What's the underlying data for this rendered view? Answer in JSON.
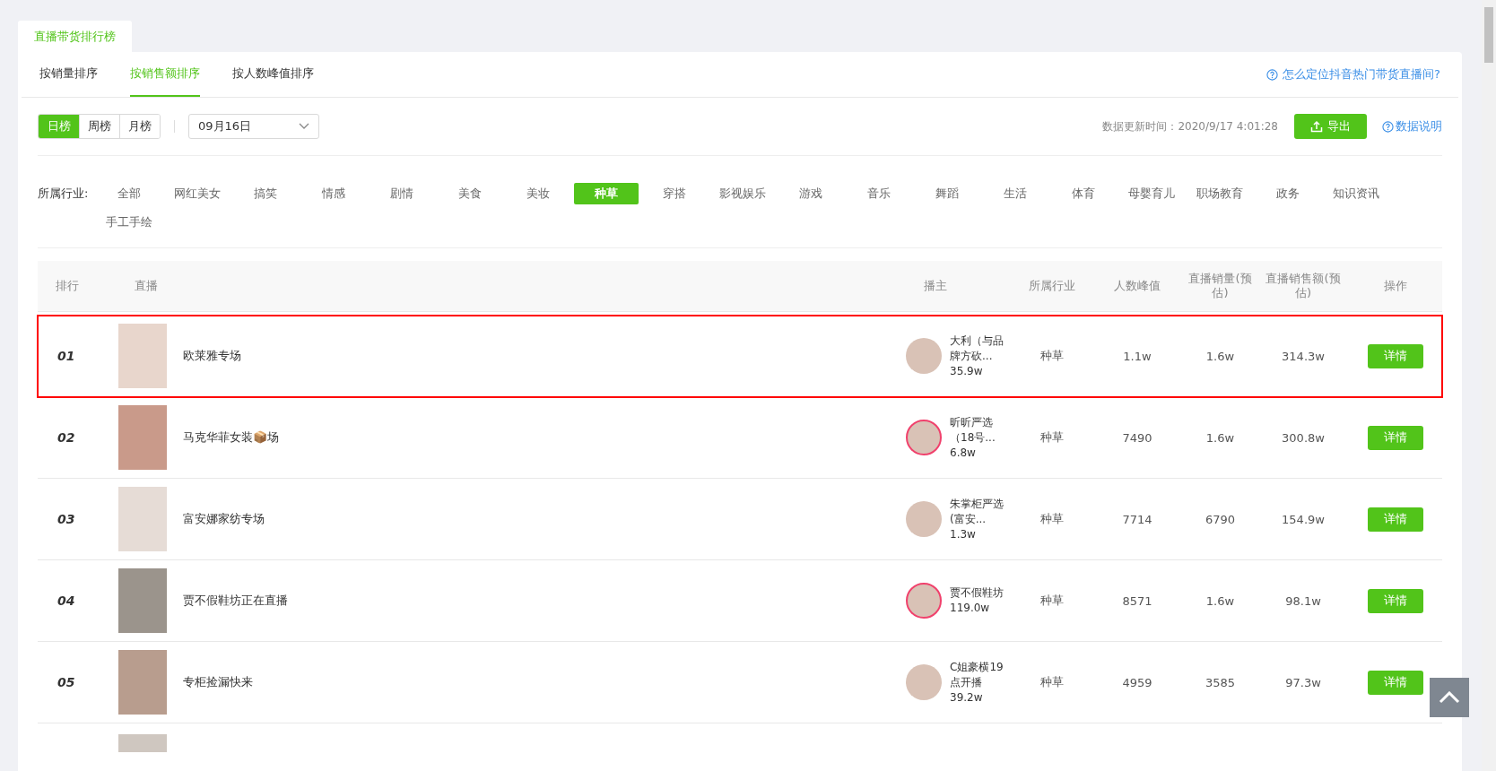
{
  "page_tab": {
    "label": "直播带货排行榜",
    "selected": true
  },
  "sort_tabs": [
    {
      "label": "按销量排序",
      "selected": false
    },
    {
      "label": "按销售额排序",
      "selected": true
    },
    {
      "label": "按人数峰值排序",
      "selected": false
    }
  ],
  "help_link": "怎么定位抖音热门带货直播间?",
  "period_tabs": [
    {
      "label": "日榜",
      "selected": true
    },
    {
      "label": "周榜",
      "selected": false
    },
    {
      "label": "月榜",
      "selected": false
    }
  ],
  "date_select": {
    "value": "09月16日"
  },
  "update_time": "数据更新时间：2020/9/17 4:01:28",
  "export_button": "导出",
  "data_note_link": "数据说明",
  "industry": {
    "label": "所属行业:",
    "items": [
      {
        "label": "全部",
        "selected": false
      },
      {
        "label": "网红美女",
        "selected": false
      },
      {
        "label": "搞笑",
        "selected": false
      },
      {
        "label": "情感",
        "selected": false
      },
      {
        "label": "剧情",
        "selected": false
      },
      {
        "label": "美食",
        "selected": false
      },
      {
        "label": "美妆",
        "selected": false
      },
      {
        "label": "种草",
        "selected": true
      },
      {
        "label": "穿搭",
        "selected": false
      },
      {
        "label": "影视娱乐",
        "selected": false
      },
      {
        "label": "游戏",
        "selected": false
      },
      {
        "label": "音乐",
        "selected": false
      },
      {
        "label": "舞蹈",
        "selected": false
      },
      {
        "label": "生活",
        "selected": false
      },
      {
        "label": "体育",
        "selected": false
      },
      {
        "label": "母婴育儿",
        "selected": false
      },
      {
        "label": "职场教育",
        "selected": false
      },
      {
        "label": "政务",
        "selected": false
      },
      {
        "label": "知识资讯",
        "selected": false
      },
      {
        "label": "手工手绘",
        "selected": false
      }
    ]
  },
  "table": {
    "columns": [
      "排行",
      "直播",
      "播主",
      "所属行业",
      "人数峰值",
      "直播销量(预估)",
      "直播销售额(预估)",
      "操作"
    ],
    "rows": [
      {
        "rank": "01",
        "live": "欧莱雅专场",
        "anchor_name": "大利（与品牌方砍...",
        "anchor_fans": "35.9w",
        "avatar_ring": false,
        "industry": "种草",
        "peak": "1.1w",
        "sales_volume": "1.6w",
        "sales_amount": "314.3w",
        "action": "详情",
        "highlighted": true
      },
      {
        "rank": "02",
        "live": "马克华菲女装📦场",
        "anchor_name": "昕昕严选（18号...",
        "anchor_fans": "6.8w",
        "avatar_ring": true,
        "industry": "种草",
        "peak": "7490",
        "sales_volume": "1.6w",
        "sales_amount": "300.8w",
        "action": "详情",
        "highlighted": false
      },
      {
        "rank": "03",
        "live": "富安娜家纺专场",
        "anchor_name": "朱掌柜严选(富安...",
        "anchor_fans": "1.3w",
        "avatar_ring": false,
        "industry": "种草",
        "peak": "7714",
        "sales_volume": "6790",
        "sales_amount": "154.9w",
        "action": "详情",
        "highlighted": false
      },
      {
        "rank": "04",
        "live": "贾不假鞋坊正在直播",
        "anchor_name": "贾不假鞋坊",
        "anchor_fans": "119.0w",
        "avatar_ring": true,
        "industry": "种草",
        "peak": "8571",
        "sales_volume": "1.6w",
        "sales_amount": "98.1w",
        "action": "详情",
        "highlighted": false
      },
      {
        "rank": "05",
        "live": "专柜捡漏快来",
        "anchor_name": "C姐豪横19点开播",
        "anchor_fans": "39.2w",
        "avatar_ring": false,
        "industry": "种草",
        "peak": "4959",
        "sales_volume": "3585",
        "sales_amount": "97.3w",
        "action": "详情",
        "highlighted": false
      }
    ],
    "more_rows_below": true
  },
  "back_to_top": true
}
